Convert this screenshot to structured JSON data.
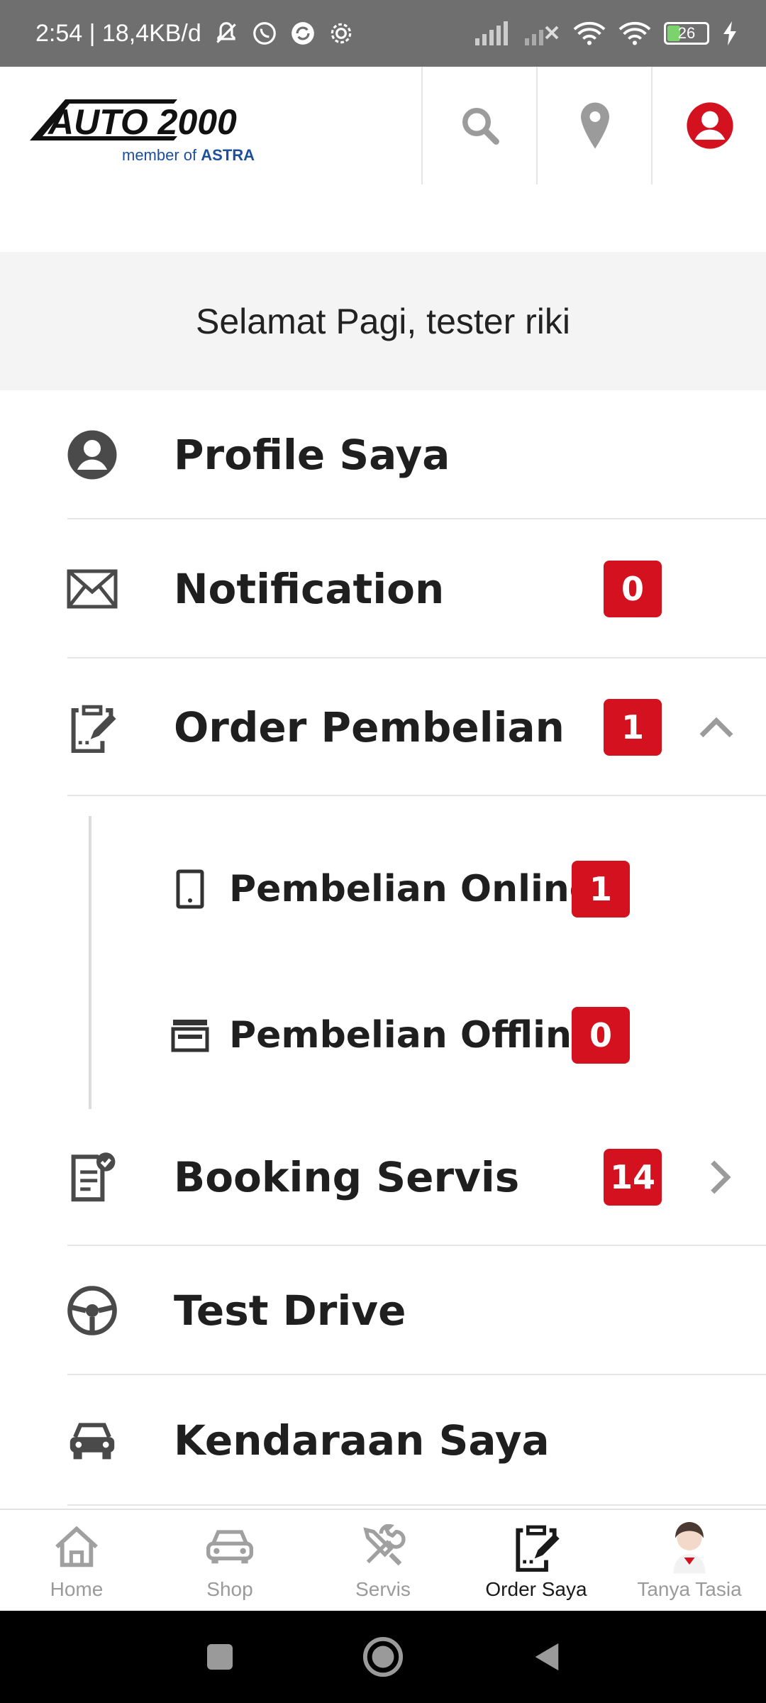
{
  "status_bar": {
    "time_speed": "2:54 | 18,4KB/d",
    "battery": "26"
  },
  "header": {
    "logo_main": "AUTO 2000",
    "logo_sub": "member of ",
    "logo_sub_brand": "ASTRA"
  },
  "greeting": "Selamat Pagi, tester riki",
  "menu": {
    "profile": "Profile Saya",
    "notification": "Notification",
    "notification_count": "0",
    "order": "Order Pembelian",
    "order_count": "1",
    "online": "Pembelian Online",
    "online_count": "1",
    "offline": "Pembelian Offline",
    "offline_count": "0",
    "booking": "Booking Servis",
    "booking_count": "14",
    "testdrive": "Test Drive",
    "kendaraan": "Kendaraan Saya"
  },
  "bottom_nav": {
    "home": "Home",
    "shop": "Shop",
    "servis": "Servis",
    "order": "Order Saya",
    "tasia": "Tanya Tasia"
  },
  "colors": {
    "brand_red": "#d4121f",
    "astra_blue": "#1d4f9c",
    "status_bar": "#6f6f6f"
  }
}
